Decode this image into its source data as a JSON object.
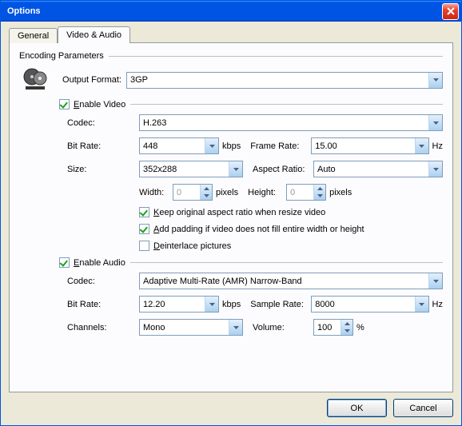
{
  "window": {
    "title": "Options"
  },
  "tabs": {
    "general": "General",
    "va": "Video & Audio"
  },
  "encoding": {
    "legend": "Encoding Parameters",
    "output_format_label": "Output Format:",
    "output_format_value": "3GP"
  },
  "video": {
    "enable_full": "Enable Video",
    "enable_u": "E",
    "enable_rest": "nable Video",
    "codec_label": "Codec:",
    "codec_value": "H.263",
    "bitrate_label": "Bit Rate:",
    "bitrate_value": "448",
    "kbps": "kbps",
    "framerate_label": "Frame Rate:",
    "framerate_value": "15.00",
    "hz": "Hz",
    "size_label": "Size:",
    "size_value": "352x288",
    "aspect_label": "Aspect Ratio:",
    "aspect_value": "Auto",
    "width_label": "Width:",
    "width_value": "0",
    "height_label": "Height:",
    "height_value": "0",
    "pixels": "pixels",
    "keep_u": "K",
    "keep_rest": "eep original aspect ratio when resize video",
    "pad_u": "A",
    "pad_rest": "dd padding if video does not fill entire width or height",
    "deint_u": "D",
    "deint_rest": "einterlace pictures"
  },
  "audio": {
    "enable_u": "E",
    "enable_rest": "nable Audio",
    "codec_label": "Codec:",
    "codec_value": "Adaptive Multi-Rate (AMR) Narrow-Band",
    "bitrate_label": "Bit Rate:",
    "bitrate_value": "12.20",
    "kbps": "kbps",
    "sample_label": "Sample Rate:",
    "sample_value": "8000",
    "hz": "Hz",
    "channels_label": "Channels:",
    "channels_value": "Mono",
    "volume_label": "Volume:",
    "volume_value": "100",
    "pct": "%"
  },
  "buttons": {
    "ok": "OK",
    "cancel": "Cancel"
  }
}
